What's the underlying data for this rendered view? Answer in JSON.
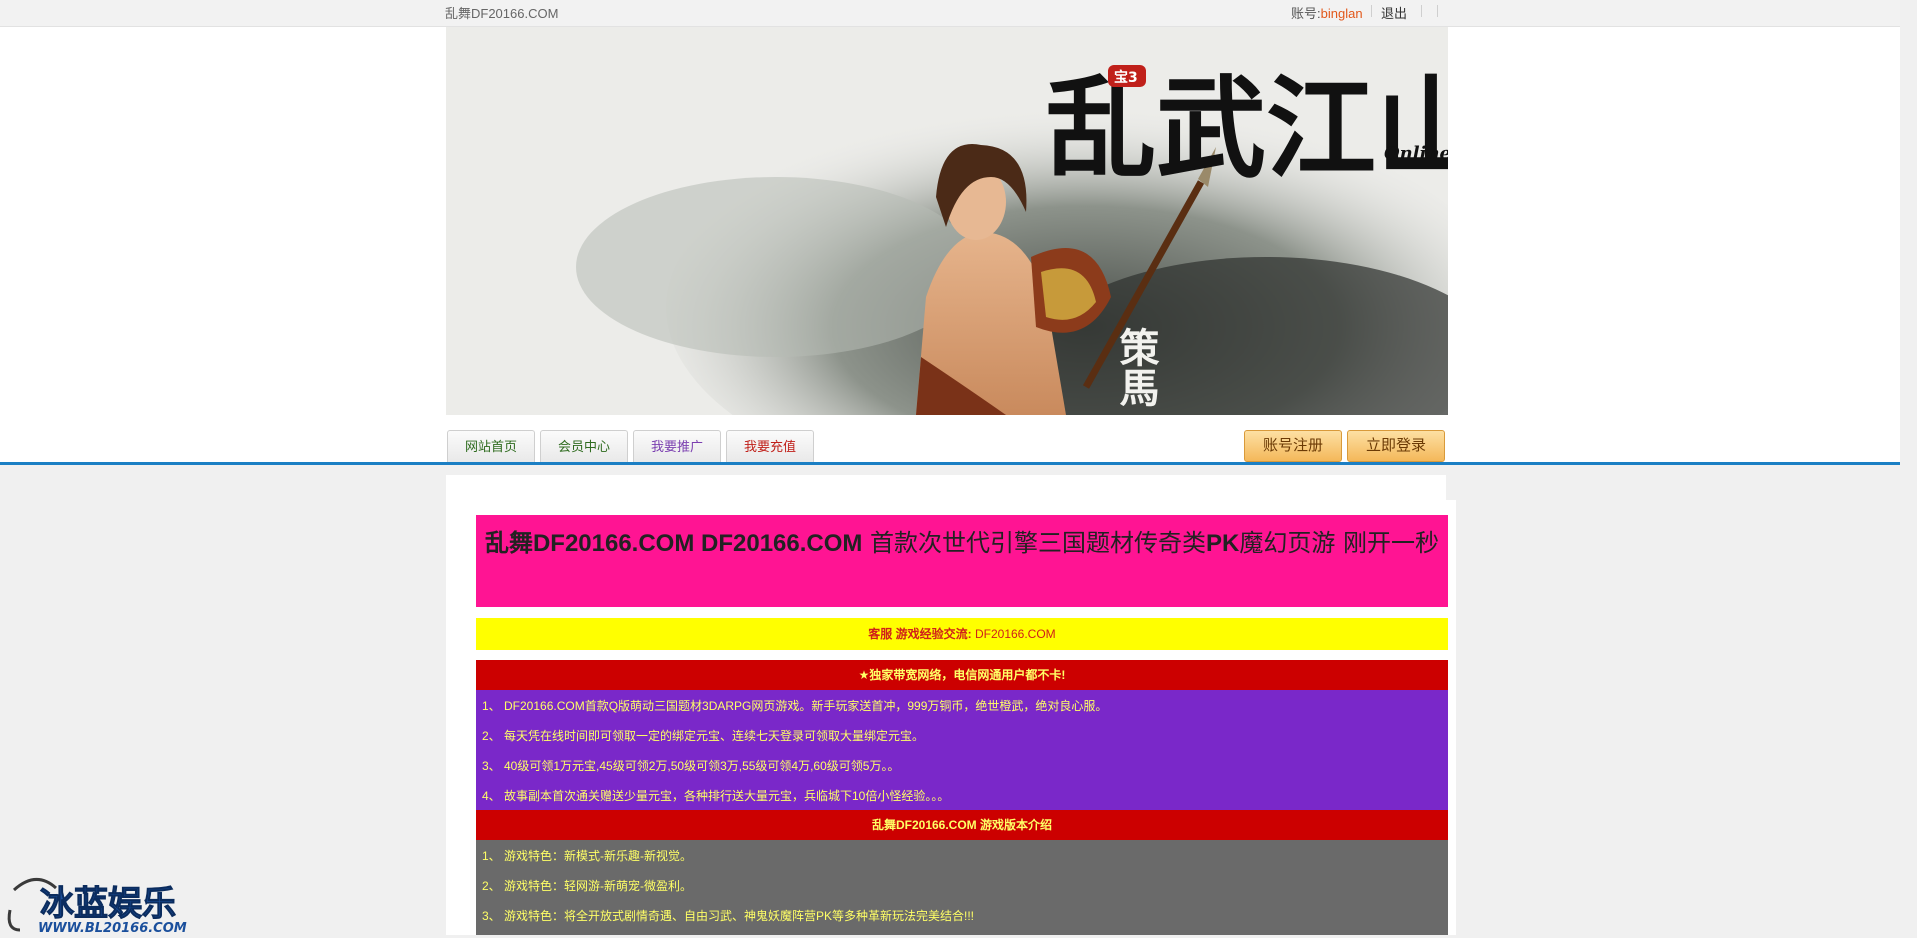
{
  "topbar": {
    "site_name": "乱舞DF20166.COM",
    "account_label": "账号:",
    "username": "binglan",
    "logout": "退出"
  },
  "banner": {
    "title": "乱武江山",
    "badge": "宝3",
    "subtitle": "Online",
    "vertical_text": "策馬"
  },
  "nav": {
    "tabs": [
      {
        "label": "网站首页",
        "color": "#2e6b1e"
      },
      {
        "label": "会员中心",
        "color": "#2e6b1e"
      },
      {
        "label": "我要推广",
        "color": "#7b3fb0"
      },
      {
        "label": "我要充值",
        "color": "#c0201a"
      }
    ],
    "register": "账号注册",
    "login": "立即登录"
  },
  "main": {
    "title_bold": "乱舞DF20166.COM DF20166.COM",
    "title_mid": "首款次世代引擎三国题材传奇类",
    "title_bold2": "PK",
    "title_tail": "魔幻页游 刚开一秒",
    "service_label": "客服 游戏经验交流:",
    "service_link": "DF20166.COM",
    "section1": {
      "header": "★独家带宽网络，电信网通用户都不卡!",
      "items": [
        "1、  DF20166.COM首款Q版萌动三国题材3DARPG网页游戏。新手玩家送首冲，999万铜币，绝世橙武，绝对良心服。",
        "2、  每天凭在线时间即可领取一定的绑定元宝、连续七天登录可领取大量绑定元宝。",
        "3、  40级可领1万元宝,45级可领2万,50级可领3万,55级可领4万,60级可领5万。。",
        "4、  故事副本首次通关赠送少量元宝，各种排行送大量元宝，兵临城下10倍小怪经验。。。"
      ]
    },
    "section2": {
      "header": "乱舞DF20166.COM 游戏版本介绍",
      "items": [
        "1、  游戏特色：新模式-新乐趣-新视觉。",
        "2、  游戏特色：轻网游-新萌宠-微盈利。",
        "3、  游戏特色：将全开放式剧情奇遇、自由习武、神鬼妖魔阵营PK等多种革新玩法完美结合!!!"
      ]
    }
  },
  "watermark": {
    "brand": "冰蓝娱乐",
    "url": "WWW.BL20166.COM"
  }
}
